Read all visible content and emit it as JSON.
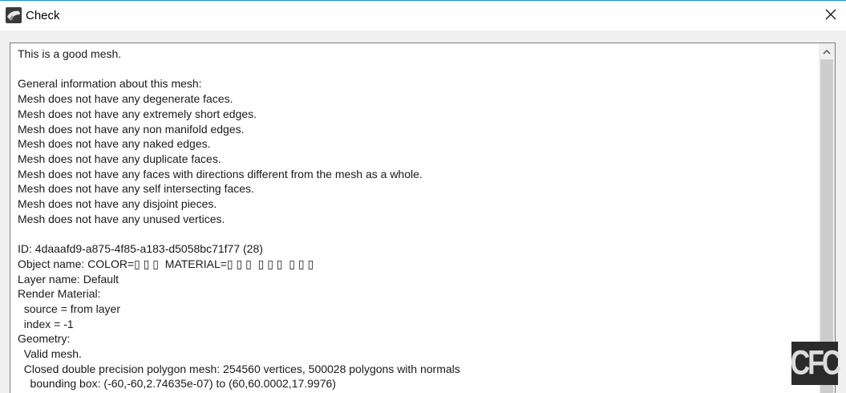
{
  "window": {
    "title": "Check",
    "app_icon": "rhino-icon",
    "close_icon": "close-icon"
  },
  "report": {
    "text": "This is a good mesh.\n\nGeneral information about this mesh:\nMesh does not have any degenerate faces.\nMesh does not have any extremely short edges.\nMesh does not have any non manifold edges.\nMesh does not have any naked edges.\nMesh does not have any duplicate faces.\nMesh does not have any faces with directions different from the mesh as a whole.\nMesh does not have any self intersecting faces.\nMesh does not have any disjoint pieces.\nMesh does not have any unused vertices.\n\nID: 4daaafd9-a875-4f85-a183-d5058bc71f77 (28)\nObject name: COLOR=▯ ▯ ▯  MATERIAL=▯ ▯ ▯  ▯ ▯ ▯  ▯ ▯ ▯\nLayer name: Default\nRender Material:\n  source = from layer\n  index = -1\nGeometry:\n  Valid mesh.\n  Closed double precision polygon mesh: 254560 vertices, 500028 polygons with normals\n    bounding box: (-60,-60,2.74635e-07) to (60,60.0002,17.9976)"
  },
  "scrollbar": {
    "up_icon": "scroll-up-arrow-icon"
  },
  "watermark": {
    "text": "CFC"
  },
  "colors": {
    "accent_line": "#1c8fd6",
    "client_background": "#f0f0f0",
    "scroll_thumb": "#cdcdcd"
  }
}
